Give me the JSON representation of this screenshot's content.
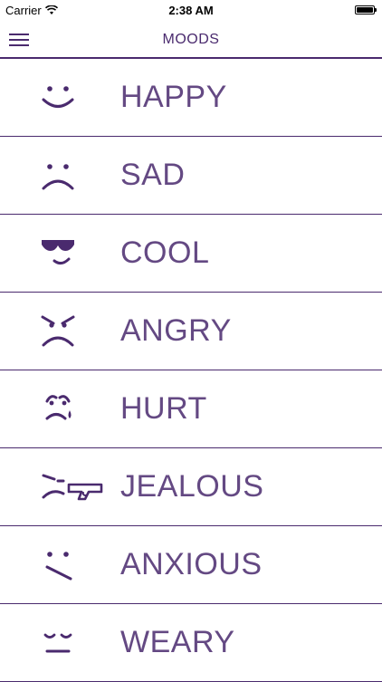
{
  "status_bar": {
    "carrier": "Carrier",
    "time": "2:38 AM",
    "icons": [
      "wifi-icon",
      "battery-icon"
    ]
  },
  "nav": {
    "title": "MOODS",
    "menu_icon": "hamburger-menu-icon"
  },
  "moods": [
    {
      "label": "HAPPY",
      "icon": "happy-face-icon"
    },
    {
      "label": "SAD",
      "icon": "sad-face-icon"
    },
    {
      "label": "COOL",
      "icon": "cool-face-icon"
    },
    {
      "label": "ANGRY",
      "icon": "angry-face-icon"
    },
    {
      "label": "HURT",
      "icon": "hurt-face-icon"
    },
    {
      "label": "JEALOUS",
      "icon": "jealous-face-icon"
    },
    {
      "label": "ANXIOUS",
      "icon": "anxious-face-icon"
    },
    {
      "label": "WEARY",
      "icon": "weary-face-icon"
    }
  ],
  "colors": {
    "accent": "#4a2a6e",
    "background": "#ffffff"
  }
}
